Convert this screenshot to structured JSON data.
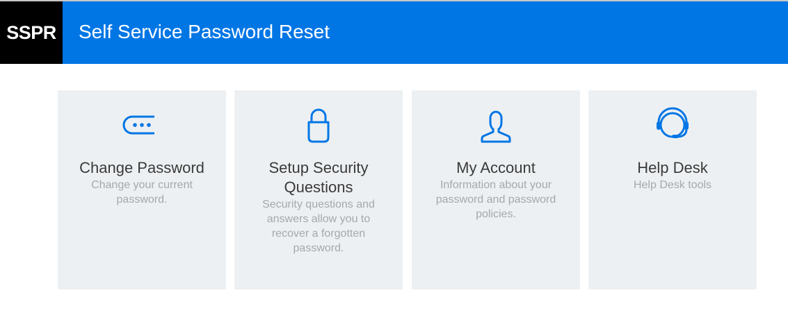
{
  "header": {
    "logo_text": "SSPR",
    "title": "Self Service Password Reset",
    "bg_color": "#0076e5"
  },
  "tiles": [
    {
      "icon": "password-dots-icon",
      "title": "Change Password",
      "description": "Change your current password."
    },
    {
      "icon": "lock-icon",
      "title": "Setup Security Questions",
      "description": "Security questions and answers allow you to recover a forgotten password."
    },
    {
      "icon": "user-icon",
      "title": "My Account",
      "description": "Information about your password and password policies."
    },
    {
      "icon": "headset-icon",
      "title": "Help Desk",
      "description": "Help Desk tools"
    }
  ],
  "colors": {
    "accent": "#0076e5",
    "tile_bg": "#edf0f2",
    "title_text": "#3a3a3a",
    "desc_text": "#a3a9ad"
  }
}
